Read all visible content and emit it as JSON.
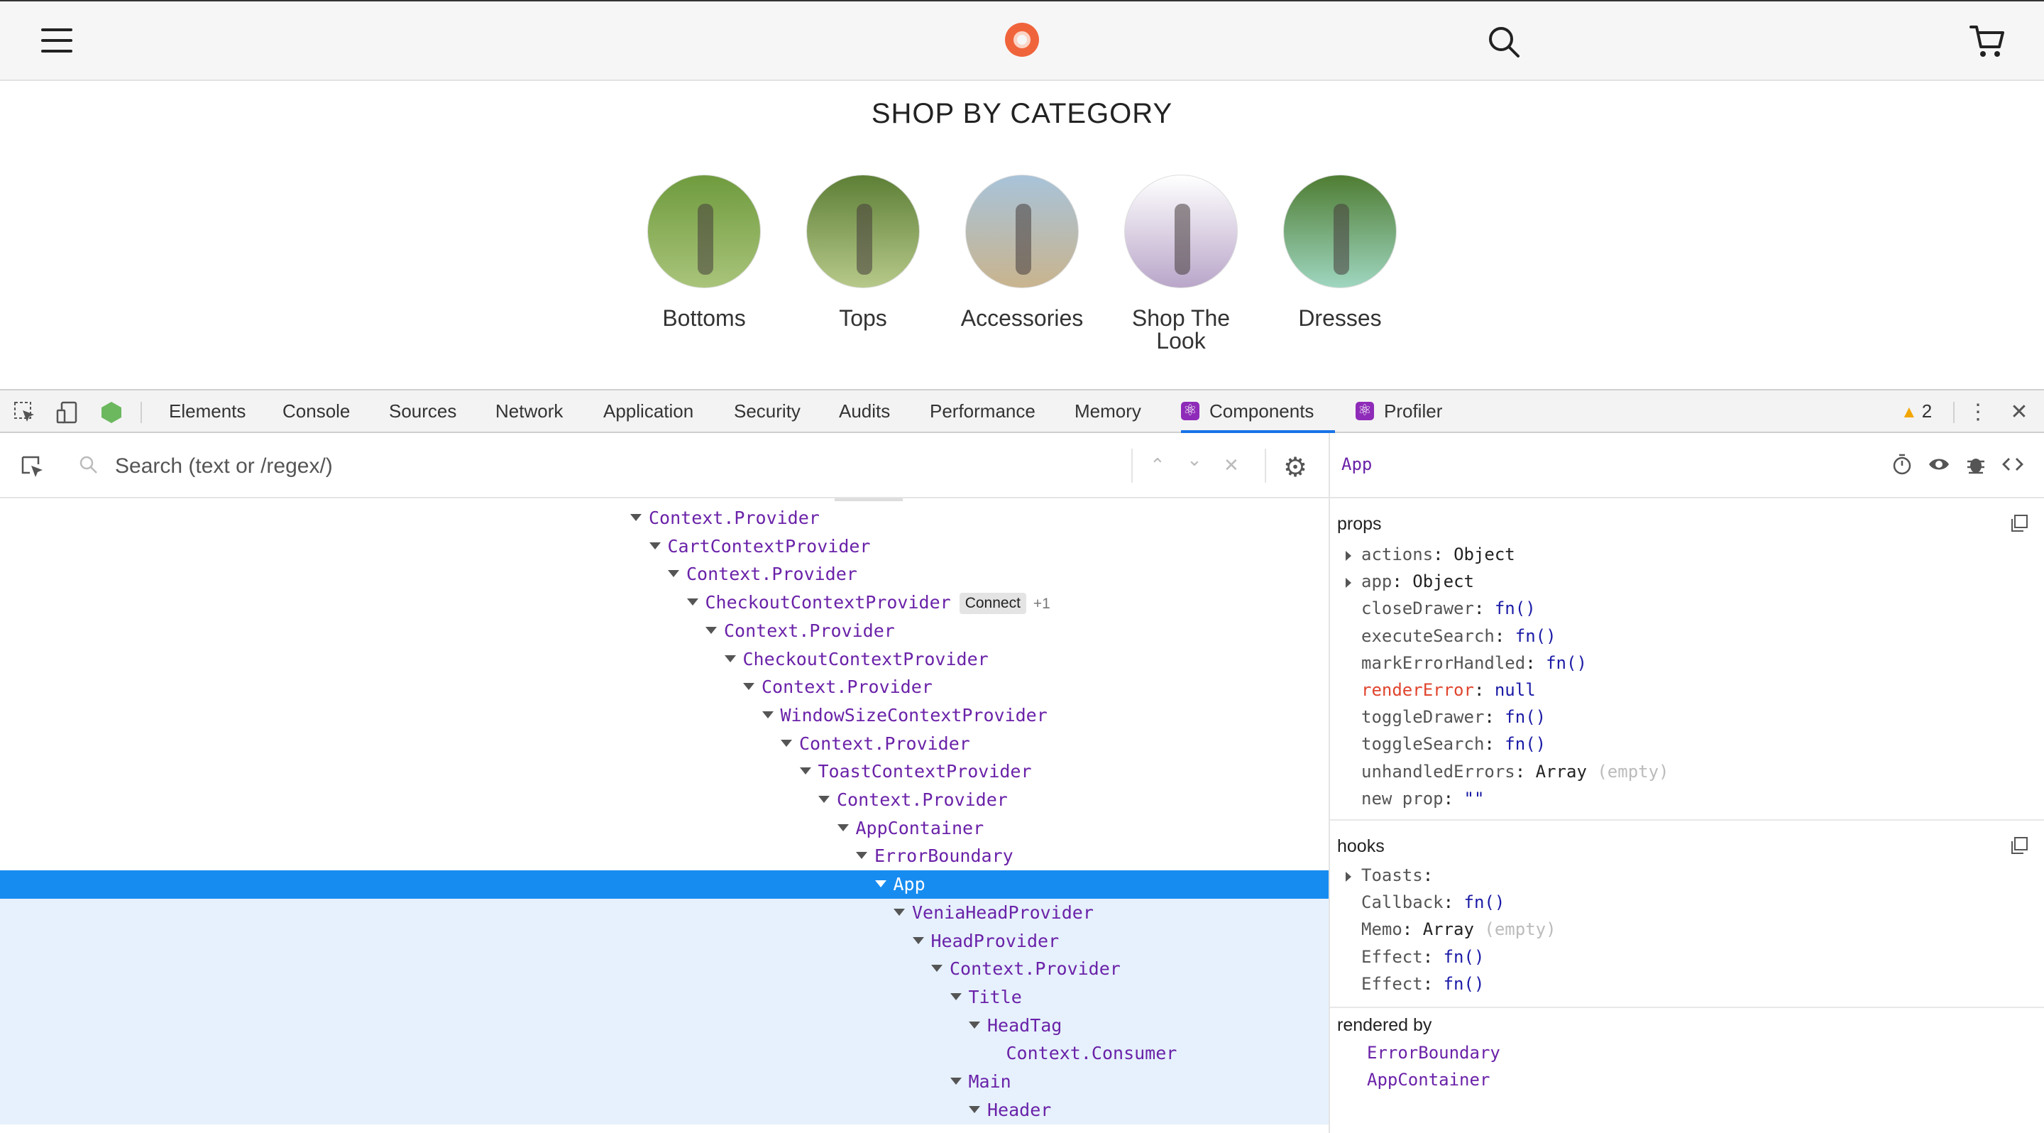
{
  "site": {
    "category_title": "SHOP BY CATEGORY",
    "categories": [
      {
        "label": "Bottoms",
        "colors": [
          "#6f9b3e",
          "#a9c47a"
        ]
      },
      {
        "label": "Tops",
        "colors": [
          "#5d7f36",
          "#b7c98a"
        ]
      },
      {
        "label": "Accessories",
        "colors": [
          "#a8c3d9",
          "#c9b48e"
        ]
      },
      {
        "label": "Shop The Look",
        "colors": [
          "#ffffff",
          "#b9a6c9"
        ]
      },
      {
        "label": "Dresses",
        "colors": [
          "#4f7d33",
          "#9fd6c0"
        ]
      }
    ]
  },
  "devtools": {
    "tabs": [
      "Elements",
      "Console",
      "Sources",
      "Network",
      "Application",
      "Security",
      "Audits",
      "Performance",
      "Memory",
      "Components",
      "Profiler"
    ],
    "active_tab": "Components",
    "warning_count": "2",
    "search_placeholder": "Search (text or /regex/)",
    "tree": [
      {
        "name": "Context.Provider",
        "depth": 0
      },
      {
        "name": "CartContextProvider",
        "depth": 1
      },
      {
        "name": "Context.Provider",
        "depth": 2
      },
      {
        "name": "CheckoutContextProvider",
        "depth": 3,
        "badge": "Connect",
        "extra": "+1"
      },
      {
        "name": "Context.Provider",
        "depth": 4
      },
      {
        "name": "CheckoutContextProvider",
        "depth": 5
      },
      {
        "name": "Context.Provider",
        "depth": 6
      },
      {
        "name": "WindowSizeContextProvider",
        "depth": 7
      },
      {
        "name": "Context.Provider",
        "depth": 8
      },
      {
        "name": "ToastContextProvider",
        "depth": 9
      },
      {
        "name": "Context.Provider",
        "depth": 10
      },
      {
        "name": "AppContainer",
        "depth": 11
      },
      {
        "name": "ErrorBoundary",
        "depth": 12
      },
      {
        "name": "App",
        "depth": 13,
        "state": "selected"
      },
      {
        "name": "VeniaHeadProvider",
        "depth": 14,
        "state": "inside"
      },
      {
        "name": "HeadProvider",
        "depth": 15,
        "state": "inside"
      },
      {
        "name": "Context.Provider",
        "depth": 16,
        "state": "inside"
      },
      {
        "name": "Title",
        "depth": 17,
        "state": "inside"
      },
      {
        "name": "HeadTag",
        "depth": 18,
        "state": "inside"
      },
      {
        "name": "Context.Consumer",
        "depth": 19,
        "state": "inside",
        "leaf": true
      },
      {
        "name": "Main",
        "depth": 17,
        "state": "inside"
      },
      {
        "name": "Header",
        "depth": 18,
        "state": "inside"
      }
    ],
    "inspector": {
      "component": "App",
      "props_label": "props",
      "props": [
        {
          "key": "actions",
          "value": "Object",
          "expandable": true
        },
        {
          "key": "app",
          "value": "Object",
          "expandable": true
        },
        {
          "key": "closeDrawer",
          "value": "fn()",
          "kind": "fn"
        },
        {
          "key": "executeSearch",
          "value": "fn()",
          "kind": "fn"
        },
        {
          "key": "markErrorHandled",
          "value": "fn()",
          "kind": "fn"
        },
        {
          "key": "renderError",
          "value": "null",
          "kind": "fn",
          "error": true
        },
        {
          "key": "toggleDrawer",
          "value": "fn()",
          "kind": "fn"
        },
        {
          "key": "toggleSearch",
          "value": "fn()",
          "kind": "fn"
        },
        {
          "key": "unhandledErrors",
          "value": "Array",
          "note": "(empty)"
        },
        {
          "key": "new prop",
          "value": "\"\"",
          "kind": "fn"
        }
      ],
      "hooks_label": "hooks",
      "hooks": [
        {
          "key": "Toasts",
          "value": "",
          "expandable": true
        },
        {
          "key": "Callback",
          "value": "fn()",
          "kind": "fn"
        },
        {
          "key": "Memo",
          "value": "Array",
          "note": "(empty)"
        },
        {
          "key": "Effect",
          "value": "fn()",
          "kind": "fn"
        },
        {
          "key": "Effect",
          "value": "fn()",
          "kind": "fn"
        }
      ],
      "rendered_by_label": "rendered by",
      "rendered_by": [
        "ErrorBoundary",
        "AppContainer"
      ]
    }
  }
}
